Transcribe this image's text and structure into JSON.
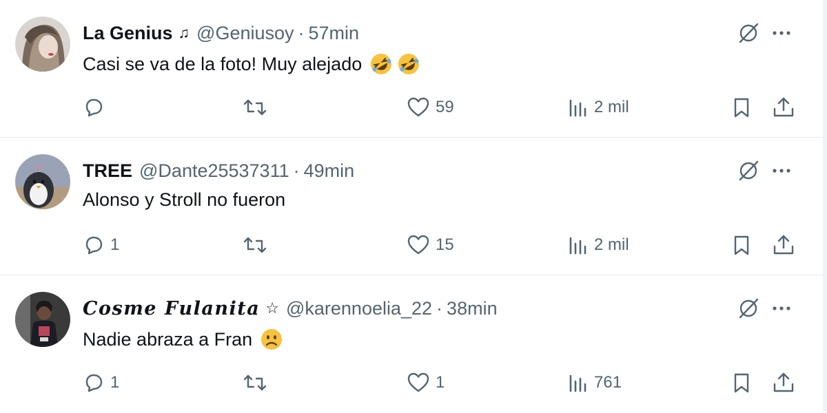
{
  "tweets": [
    {
      "name": "La Genius",
      "name_glyph": "♫",
      "handle": "@Geniusoy",
      "separator": "·",
      "time": "57min",
      "text": "Casi se va de la foto! Muy alejado",
      "emoji": [
        "rolling-on-floor-laughing",
        "rolling-on-floor-laughing"
      ],
      "replies": "",
      "retweets": "",
      "likes": "59",
      "views": "2 mil"
    },
    {
      "name": "TREE",
      "name_glyph": "",
      "handle": "@Dante25537311",
      "separator": "·",
      "time": "49min",
      "text": "Alonso y Stroll no fueron",
      "emoji": [],
      "replies": "1",
      "retweets": "",
      "likes": "15",
      "views": "2 mil"
    },
    {
      "name": "𝑪𝒐𝒔𝒎𝒆 𝑭𝒖𝒍𝒂𝒏𝒊𝒕𝒂",
      "name_glyph": "☆",
      "handle": "@karennoelia_22",
      "separator": "·",
      "time": "38min",
      "text": "Nadie abraza a Fran",
      "emoji": [
        "slightly-frowning-face"
      ],
      "replies": "1",
      "retweets": "",
      "likes": "1",
      "views": "761"
    }
  ],
  "icons": {
    "grok": "grok-icon",
    "more": "more-icon",
    "reply": "reply-icon",
    "retweet": "retweet-icon",
    "like": "heart-icon",
    "views": "views-icon",
    "bookmark": "bookmark-icon",
    "share": "share-icon"
  },
  "colors": {
    "text_primary": "#0f1419",
    "text_secondary": "#536471",
    "divider": "#e7e9ea"
  }
}
